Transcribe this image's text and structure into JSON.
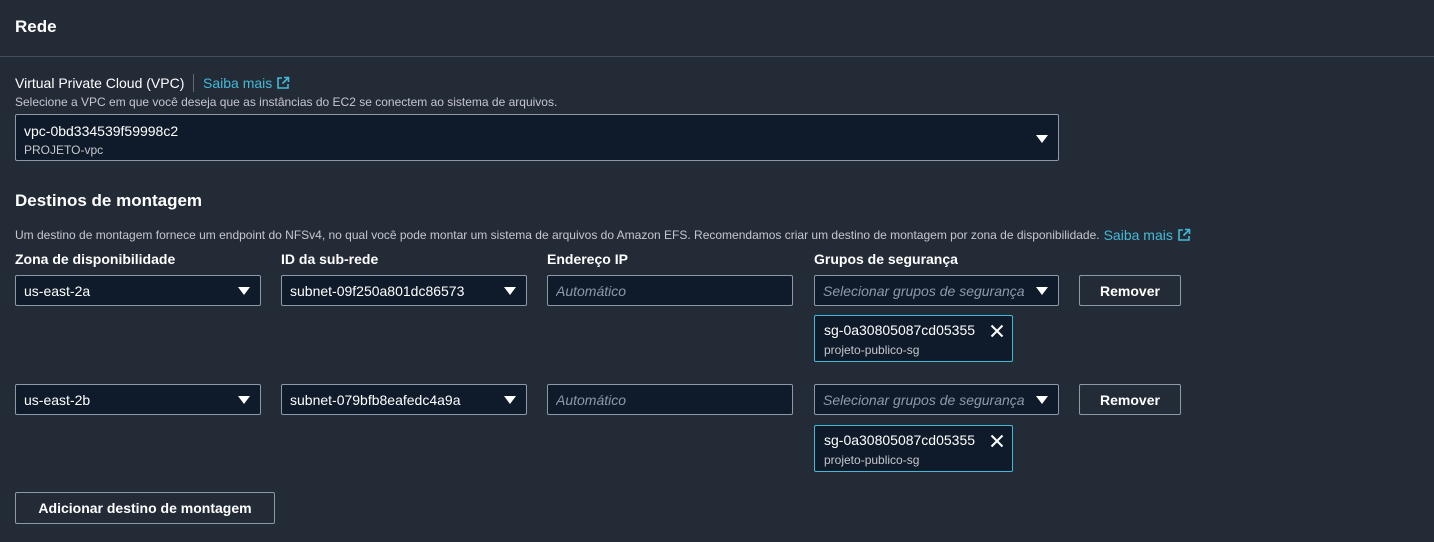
{
  "section": {
    "title": "Rede"
  },
  "vpc": {
    "label": "Virtual Private Cloud (VPC)",
    "learn_more": "Saiba mais",
    "description": "Selecione a VPC em que você deseja que as instâncias do EC2 se conectem ao sistema de arquivos.",
    "selected_id": "vpc-0bd334539f59998c2",
    "selected_name": "PROJETO-vpc"
  },
  "mount_targets": {
    "title": "Destinos de montagem",
    "description": "Um destino de montagem fornece um endpoint do NFSv4, no qual você pode montar um sistema de arquivos do Amazon EFS. Recomendamos criar um destino de montagem por zona de disponibilidade.",
    "learn_more": "Saiba mais",
    "columns": {
      "az": "Zona de disponibilidade",
      "subnet": "ID da sub-rede",
      "ip": "Endereço IP",
      "sg": "Grupos de segurança"
    },
    "rows": [
      {
        "az": "us-east-2a",
        "subnet": "subnet-09f250a801dc86573",
        "ip_placeholder": "Automático",
        "sg_placeholder": "Selecionar grupos de segurança",
        "remove_label": "Remover",
        "token": {
          "id": "sg-0a30805087cd05355",
          "name": "projeto-publico-sg"
        }
      },
      {
        "az": "us-east-2b",
        "subnet": "subnet-079bfb8eafedc4a9a",
        "ip_placeholder": "Automático",
        "sg_placeholder": "Selecionar grupos de segurança",
        "remove_label": "Remover",
        "token": {
          "id": "sg-0a30805087cd05355",
          "name": "projeto-publico-sg"
        }
      }
    ],
    "add_label": "Adicionar destino de montagem"
  },
  "colors": {
    "background": "#232b37",
    "input_background": "#0f1b2a",
    "link": "#44b9d6",
    "border": "#8d99a8"
  },
  "icons": [
    "external-link-icon",
    "caret-down-icon",
    "close-icon"
  ]
}
